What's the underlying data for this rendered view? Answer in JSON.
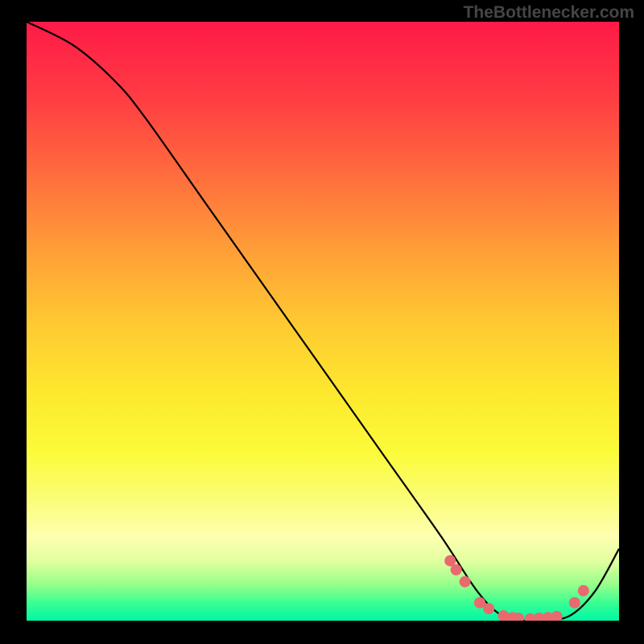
{
  "watermark": "TheBottlenecker.com",
  "chart_data": {
    "type": "line",
    "title": "",
    "xlabel": "",
    "ylabel": "",
    "xlim": [
      0,
      100
    ],
    "ylim": [
      0,
      100
    ],
    "curve": {
      "x": [
        0,
        8,
        15,
        20,
        30,
        40,
        50,
        60,
        70,
        76,
        80,
        84,
        88,
        92,
        96,
        100
      ],
      "y": [
        100,
        96,
        90,
        84,
        70,
        56,
        42,
        28,
        14,
        5,
        1,
        0,
        0,
        1,
        5,
        12
      ]
    },
    "markers": {
      "x": [
        71.5,
        72.5,
        74,
        76.5,
        78,
        80.5,
        82,
        83,
        85,
        86.5,
        88,
        89.5,
        92.5,
        94
      ],
      "y": [
        10,
        8.5,
        6.5,
        3,
        2,
        0.8,
        0.5,
        0.4,
        0.3,
        0.4,
        0.5,
        0.7,
        3,
        5
      ],
      "color": "#e86a6f",
      "size": 7
    },
    "colors": {
      "line": "#000000",
      "gradient_top": "#ff1a48",
      "gradient_bottom": "#00f7a7"
    },
    "grid": false,
    "legend": false
  }
}
